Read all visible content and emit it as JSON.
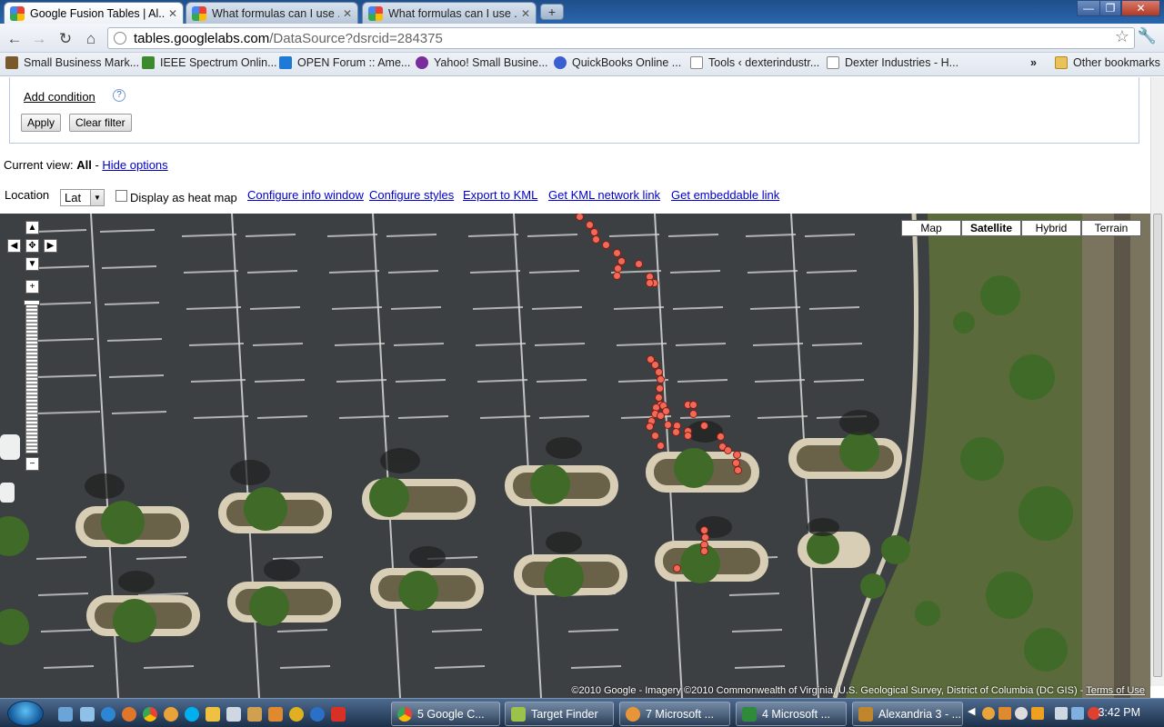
{
  "browser": {
    "tabs": [
      {
        "title": "Google Fusion Tables | Al...",
        "active": true
      },
      {
        "title": "What formulas can I use ...",
        "active": false
      },
      {
        "title": "What formulas can I use ...",
        "active": false
      }
    ],
    "new_tab_glyph": "+",
    "window_controls": {
      "minimize": "—",
      "maximize": "❐",
      "close": "✕"
    },
    "url_host": "tables.googlelabs.com",
    "url_path": "/DataSource?dsrcid=284375",
    "nav": {
      "back": "←",
      "forward": "→",
      "reload": "↻",
      "home": "⌂"
    },
    "star_icon": "☆",
    "wrench_icon": "🔧"
  },
  "bookmarks": {
    "items": [
      {
        "label": "Small Business Mark...",
        "color": "#8a6d3b"
      },
      {
        "label": "IEEE Spectrum Onlin...",
        "color": "#3c8a2f"
      },
      {
        "label": "OPEN Forum :: Ame...",
        "color": "#1e7ad6"
      },
      {
        "label": "Yahoo! Small Busine...",
        "color": "#7b2c9c"
      },
      {
        "label": "QuickBooks Online ...",
        "color": "#3a5fd0"
      },
      {
        "label": "Tools ‹ dexterindustr...",
        "color": "#ffffff"
      },
      {
        "label": "Dexter Industries - H...",
        "color": "#ffffff"
      }
    ],
    "overflow": "»",
    "other": "Other bookmarks"
  },
  "filter": {
    "add_condition": "Add condition",
    "help": "?",
    "apply": "Apply",
    "clear": "Clear filter"
  },
  "view": {
    "prefix": "Current view: ",
    "name": "All",
    "sep": " - ",
    "hide_options": "Hide options"
  },
  "options": {
    "location_label": "Location",
    "location_value": "Lat",
    "heatmap_label": "Display as heat map",
    "links": [
      "Configure info window",
      "Configure styles",
      "Export to KML",
      "Get KML network link",
      "Get embeddable link"
    ]
  },
  "map": {
    "types": [
      "Map",
      "Satellite",
      "Hybrid",
      "Terrain"
    ],
    "selected_type": "Satellite",
    "zoom_in": "+",
    "zoom_out": "−",
    "attribution": "©2010 Google - Imagery ©2010 Commonwealth of Virginia, U.S. Geological Survey, District of Columbia (DC GIS) - ",
    "terms": "Terms of Use",
    "marker_color": "#f06a5a"
  },
  "taskbar": {
    "buttons": [
      {
        "label": "5 Google C...",
        "color": "#e8a33a"
      },
      {
        "label": "Target Finder",
        "color": "#9bc24a"
      },
      {
        "label": "7 Microsoft ...",
        "color": "#e8953a"
      },
      {
        "label": "4 Microsoft ...",
        "color": "#2f8a3c"
      },
      {
        "label": "Alexandria 3 - ...",
        "color": "#c0862e"
      }
    ],
    "clock": "3:42 PM"
  }
}
